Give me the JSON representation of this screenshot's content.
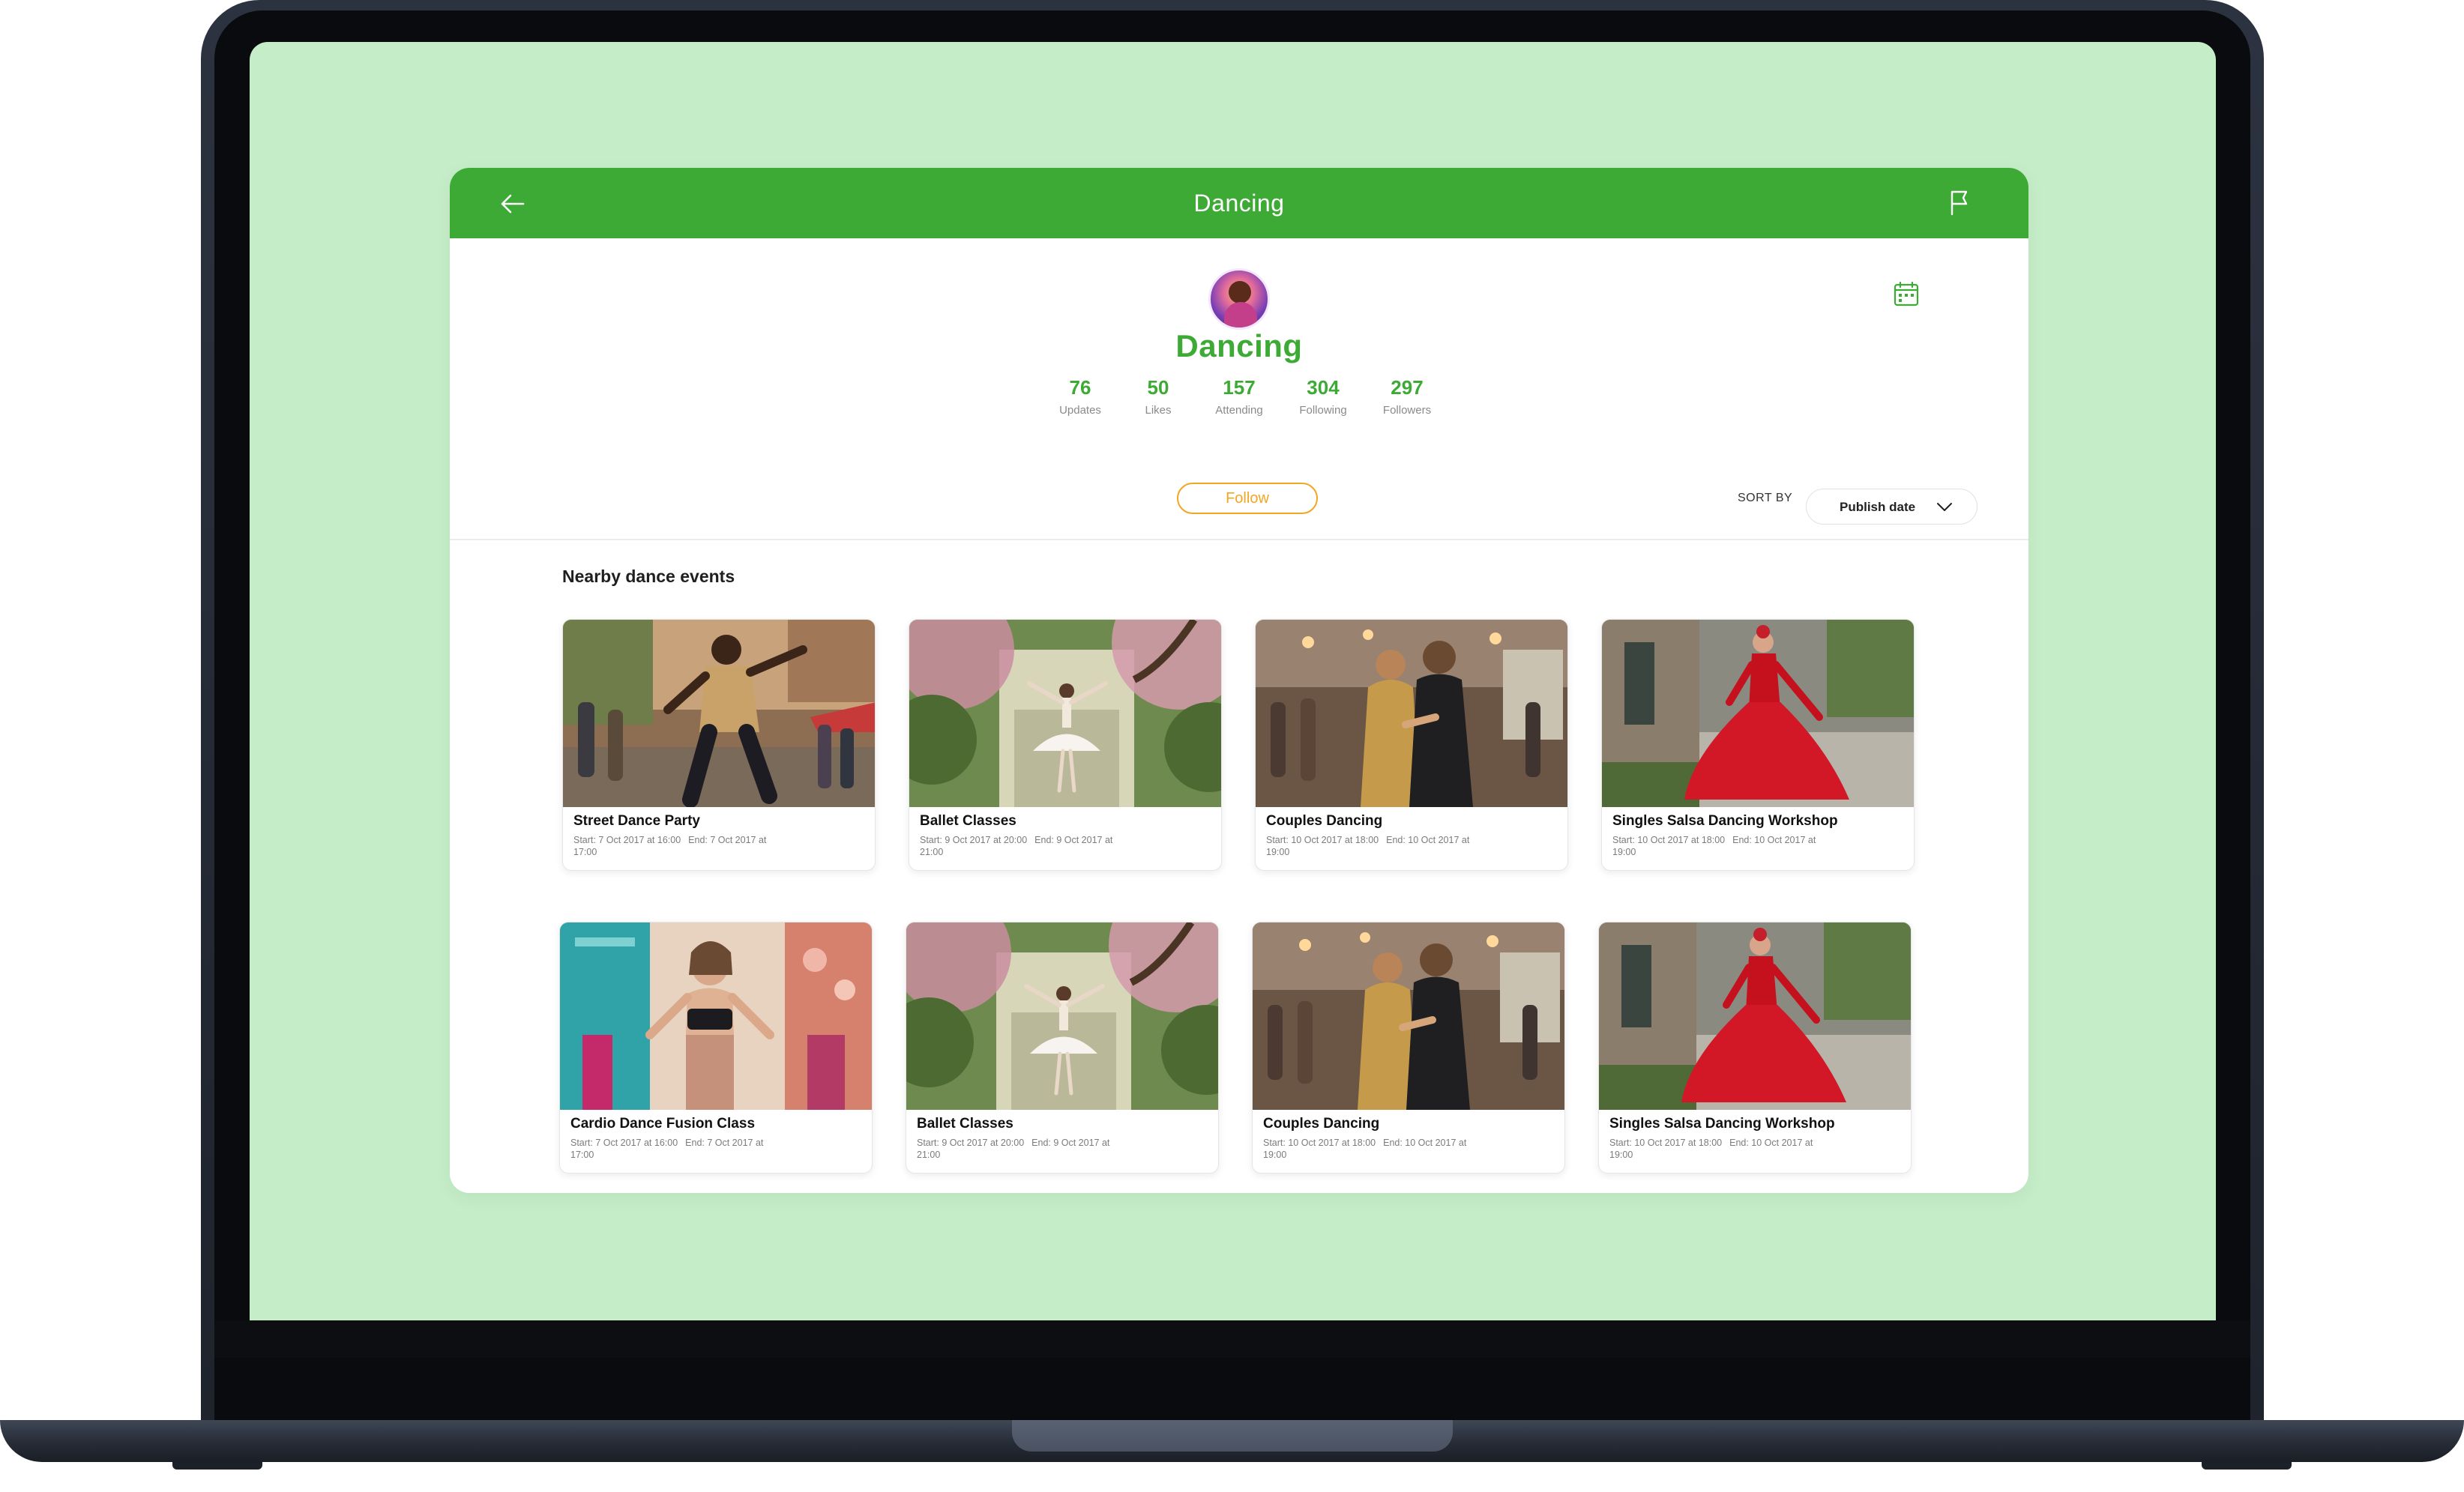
{
  "header": {
    "title": "Dancing",
    "back_icon": "arrow-left-icon",
    "flag_icon": "flag-icon"
  },
  "profile": {
    "name": "Dancing",
    "calendar_icon": "calendar-icon",
    "stats": [
      {
        "value": "76",
        "label": "Updates"
      },
      {
        "value": "50",
        "label": "Likes"
      },
      {
        "value": "157",
        "label": "Attending"
      },
      {
        "value": "304",
        "label": "Following"
      },
      {
        "value": "297",
        "label": "Followers"
      }
    ],
    "follow_label": "Follow"
  },
  "sort": {
    "label": "SORT BY",
    "selected": "Publish date",
    "chevron_icon": "chevron-down-icon"
  },
  "section": {
    "title": "Nearby dance events"
  },
  "events": [
    {
      "title": "Street Dance Party",
      "start": "Start: 7 Oct 2017 at 16:00",
      "end": "End: 7 Oct 2017 at 17:00"
    },
    {
      "title": "Ballet Classes",
      "start": "Start: 9 Oct 2017 at 20:00",
      "end": "End: 9 Oct 2017 at 21:00"
    },
    {
      "title": "Couples Dancing",
      "start": "Start: 10 Oct 2017 at 18:00",
      "end": "End: 10 Oct 2017 at 19:00"
    },
    {
      "title": "Singles Salsa Dancing Workshop",
      "start": "Start: 10 Oct 2017 at 18:00",
      "end": "End: 10 Oct 2017 at 19:00"
    },
    {
      "title": "Cardio Dance Fusion Class",
      "start": "Start: 7 Oct 2017 at 16:00",
      "end": "End: 7 Oct 2017 at 17:00"
    },
    {
      "title": "Ballet Classes",
      "start": "Start: 9 Oct 2017 at 20:00",
      "end": "End: 9 Oct 2017 at 21:00"
    },
    {
      "title": "Couples Dancing",
      "start": "Start: 10 Oct 2017 at 18:00",
      "end": "End: 10 Oct 2017 at 19:00"
    },
    {
      "title": "Singles Salsa Dancing Workshop",
      "start": "Start: 10 Oct 2017 at 18:00",
      "end": "End: 10 Oct 2017 at 19:00"
    }
  ],
  "colors": {
    "brand_green": "#3daa36",
    "follow_orange": "#f2a623",
    "screen_background": "#c5eec8"
  }
}
